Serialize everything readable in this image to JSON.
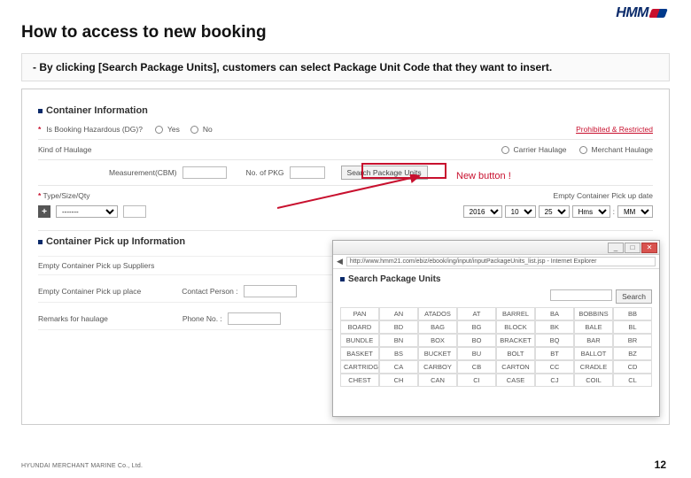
{
  "brand": "HMM",
  "title": "How to access to new booking",
  "instruction": "- By clicking [Search Package Units], customers can select Package Unit Code that they want to insert.",
  "footer_company": "HYUNDAI MERCHANT MARINE Co., Ltd.",
  "page_number": "12",
  "annotation": "New button !",
  "app": {
    "section1": "Container Information",
    "hazardous_label": "Is Booking Hazardous (DG)?",
    "yes": "Yes",
    "no": "No",
    "prohibited": "Prohibited & Restricted",
    "kind_of_haulage": "Kind of Haulage",
    "carrier_haulage": "Carrier Haulage",
    "merchant_haulage": "Merchant Haulage",
    "measurement": "Measurement(CBM)",
    "no_of_pkg": "No. of PKG",
    "search_pkg_btn": "Search Package Units",
    "type_size_qty": "Type/Size/Qty",
    "empty_pickup_date": "Empty Container Pick up date",
    "section2": "Container Pick up Information",
    "empty_suppliers": "Empty Container Pick up Suppliers",
    "empty_place": "Empty Container Pick up place",
    "remarks": "Remarks for haulage",
    "contact_person": "Contact Person :",
    "phone_no": "Phone No. :",
    "year": "2016",
    "month": "10",
    "day": "25",
    "hm": "Hms",
    "mm": "MM"
  },
  "popup": {
    "url": "http://www.hmm21.com/ebiz/ebook/ing/input/inputPackageUnits_list.jsp - Internet Explorer",
    "title": "Search Package Units",
    "search_btn": "Search",
    "rows": [
      [
        "PAN",
        "AN",
        "ATADOS",
        "AT",
        "BARREL",
        "BA",
        "BOBBINS",
        "BB"
      ],
      [
        "BOARD",
        "BD",
        "BAG",
        "BG",
        "BLOCK",
        "BK",
        "BALE",
        "BL"
      ],
      [
        "BUNDLE",
        "BN",
        "BOX",
        "BO",
        "BRACKET",
        "BQ",
        "BAR",
        "BR"
      ],
      [
        "BASKET",
        "BS",
        "BUCKET",
        "BU",
        "BOLT",
        "BT",
        "BALLOT",
        "BZ"
      ],
      [
        "CARTRIDGE",
        "CA",
        "CARBOY",
        "CB",
        "CARTON",
        "CC",
        "CRADLE",
        "CD"
      ],
      [
        "CHEST",
        "CH",
        "CAN",
        "CI",
        "CASE",
        "CJ",
        "COIL",
        "CL"
      ]
    ]
  }
}
